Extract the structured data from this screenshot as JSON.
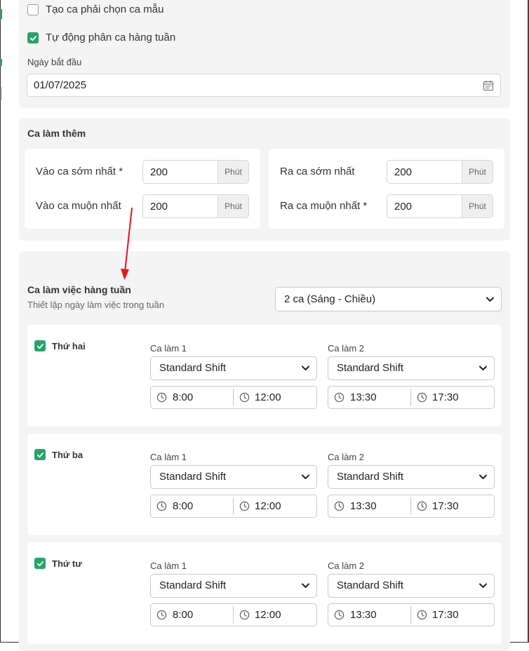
{
  "general": {
    "template_shift_option": {
      "label": "Tạo ca phải chọn ca mẫu",
      "checked": false
    },
    "auto_assign_option": {
      "label": "Tự động phân ca hàng tuần",
      "checked": true
    },
    "start_date_label": "Ngày bắt đầu",
    "start_date_value": "01/07/2025"
  },
  "overtime": {
    "title": "Ca làm thêm",
    "unit": "Phút",
    "rows": [
      {
        "label": "Vào ca sớm nhất *",
        "value": "200"
      },
      {
        "label": "Vào ca muộn nhất",
        "value": "200"
      },
      {
        "label": "Ra ca sớm nhất",
        "value": "200"
      },
      {
        "label": "Ra ca muộn nhất *",
        "value": "200"
      }
    ]
  },
  "weekly": {
    "title": "Ca làm việc hàng tuần",
    "subtitle": "Thiết lập ngày làm việc trong tuần",
    "shift_count_selected": "2 ca (Sáng - Chiều)",
    "shift1_label": "Ca làm 1",
    "shift2_label": "Ca làm 2",
    "days": [
      {
        "name": "Thứ hai",
        "checked": true,
        "shift1": "Standard Shift",
        "shift2": "Standard Shift",
        "s1_start": "8:00",
        "s1_end": "12:00",
        "s2_start": "13:30",
        "s2_end": "17:30"
      },
      {
        "name": "Thứ ba",
        "checked": true,
        "shift1": "Standard Shift",
        "shift2": "Standard Shift",
        "s1_start": "8:00",
        "s1_end": "12:00",
        "s2_start": "13:30",
        "s2_end": "17:30"
      },
      {
        "name": "Thứ tư",
        "checked": true,
        "shift1": "Standard Shift",
        "shift2": "Standard Shift",
        "s1_start": "8:00",
        "s1_end": "12:00",
        "s2_start": "13:30",
        "s2_end": "17:30"
      }
    ]
  },
  "colors": {
    "accent_green": "#28a36a",
    "arrow_red": "#e8141b",
    "panel_bg": "#f4f4f5"
  },
  "icons": {
    "check": "check-icon",
    "calendar": "calendar-icon",
    "clock": "clock-icon",
    "chevron": "chevron-down-icon"
  }
}
